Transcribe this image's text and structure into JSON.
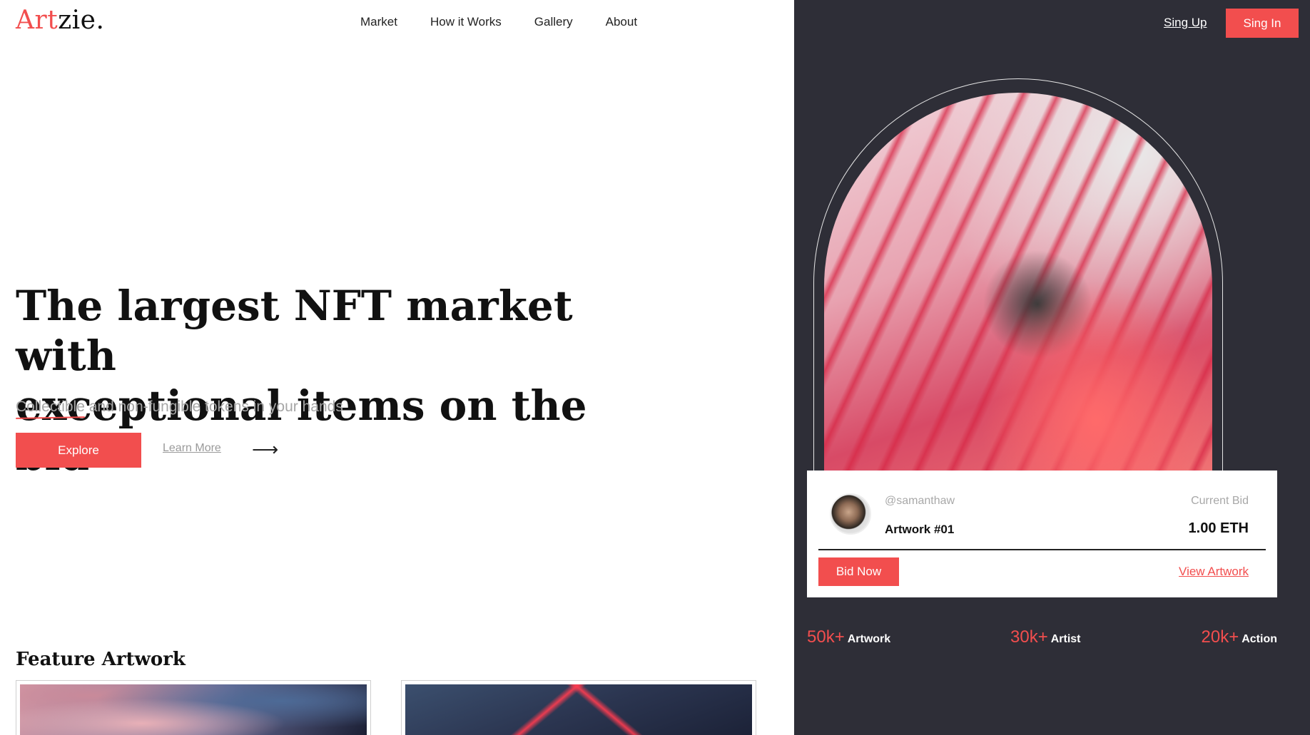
{
  "brand": {
    "logo_accent": "Art",
    "logo_rest": "zie.",
    "accent_color": "#f24e4e"
  },
  "nav": {
    "items": [
      "Market",
      "How it Works",
      "Gallery",
      "About"
    ]
  },
  "auth": {
    "sign_up": "Sing Up",
    "sign_in": "Sing In"
  },
  "hero": {
    "title_line1": "The largest NFT market with",
    "title_line2": "exceptional items on the bid",
    "subtitle_highlight": "Collectible",
    "subtitle_rest": " and non-fungible tokens in your hands",
    "explore_label": "Explore",
    "learn_more_label": "Learn More",
    "arrow_icon": "arrow-right-icon"
  },
  "featured": {
    "title": "Feature Artwork"
  },
  "bid_card": {
    "handle": "@samanthaw",
    "artwork_name": "Artwork #01",
    "current_bid_label": "Current Bid",
    "current_bid_value": "1.00 ETH",
    "bid_now_label": "Bid Now",
    "view_artwork_label": "View Artwork"
  },
  "stats": [
    {
      "value": "50k+",
      "label": "Artwork"
    },
    {
      "value": "30k+",
      "label": "Artist"
    },
    {
      "value": "20k+",
      "label": "Action"
    }
  ],
  "colors": {
    "dark_panel": "#2e2e37",
    "accent": "#f24e4e"
  }
}
